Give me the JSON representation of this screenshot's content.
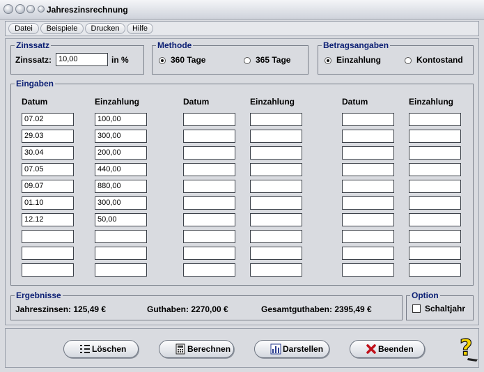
{
  "window": {
    "title": "Jahreszinsrechnung"
  },
  "menu": [
    "Datei",
    "Beispiele",
    "Drucken",
    "Hilfe"
  ],
  "zinssatz": {
    "legend": "Zinssatz",
    "label": "Zinssatz:",
    "value": "10,00",
    "unit": "in %"
  },
  "methode": {
    "legend": "Methode",
    "opt1": "360 Tage",
    "opt2": "365 Tage",
    "selected": "360 Tage"
  },
  "betrag": {
    "legend": "Betragsangaben",
    "opt1": "Einzahlung",
    "opt2": "Kontostand",
    "selected": "Einzahlung"
  },
  "eingaben": {
    "legend": "Eingaben",
    "headers": [
      "Datum",
      "Einzahlung",
      "Datum",
      "Einzahlung",
      "Datum",
      "Einzahlung"
    ],
    "rows": [
      [
        "07.02",
        "100,00",
        "",
        "",
        "",
        ""
      ],
      [
        "29.03",
        "300,00",
        "",
        "",
        "",
        ""
      ],
      [
        "30.04",
        "200,00",
        "",
        "",
        "",
        ""
      ],
      [
        "07.05",
        "440,00",
        "",
        "",
        "",
        ""
      ],
      [
        "09.07",
        "880,00",
        "",
        "",
        "",
        ""
      ],
      [
        "01.10",
        "300,00",
        "",
        "",
        "",
        ""
      ],
      [
        "12.12",
        " 50,00",
        "",
        "",
        "",
        ""
      ],
      [
        "",
        "",
        "",
        "",
        "",
        ""
      ],
      [
        "",
        "",
        "",
        "",
        "",
        ""
      ],
      [
        "",
        "",
        "",
        "",
        "",
        ""
      ]
    ]
  },
  "ergebnisse": {
    "legend": "Ergebnisse",
    "jahreszinsen": "Jahreszinsen: 125,49 €",
    "guthaben": "Guthaben: 2270,00 €",
    "gesamt": "Gesamtguthaben: 2395,49 €"
  },
  "option": {
    "legend": "Option",
    "label": "Schaltjahr",
    "checked": false
  },
  "buttons": {
    "loeschen": "Löschen",
    "berechnen": "Berechnen",
    "darstellen": "Darstellen",
    "beenden": "Beenden"
  },
  "colors": {
    "legend": "#0a1e73",
    "close": "#c0101a"
  }
}
